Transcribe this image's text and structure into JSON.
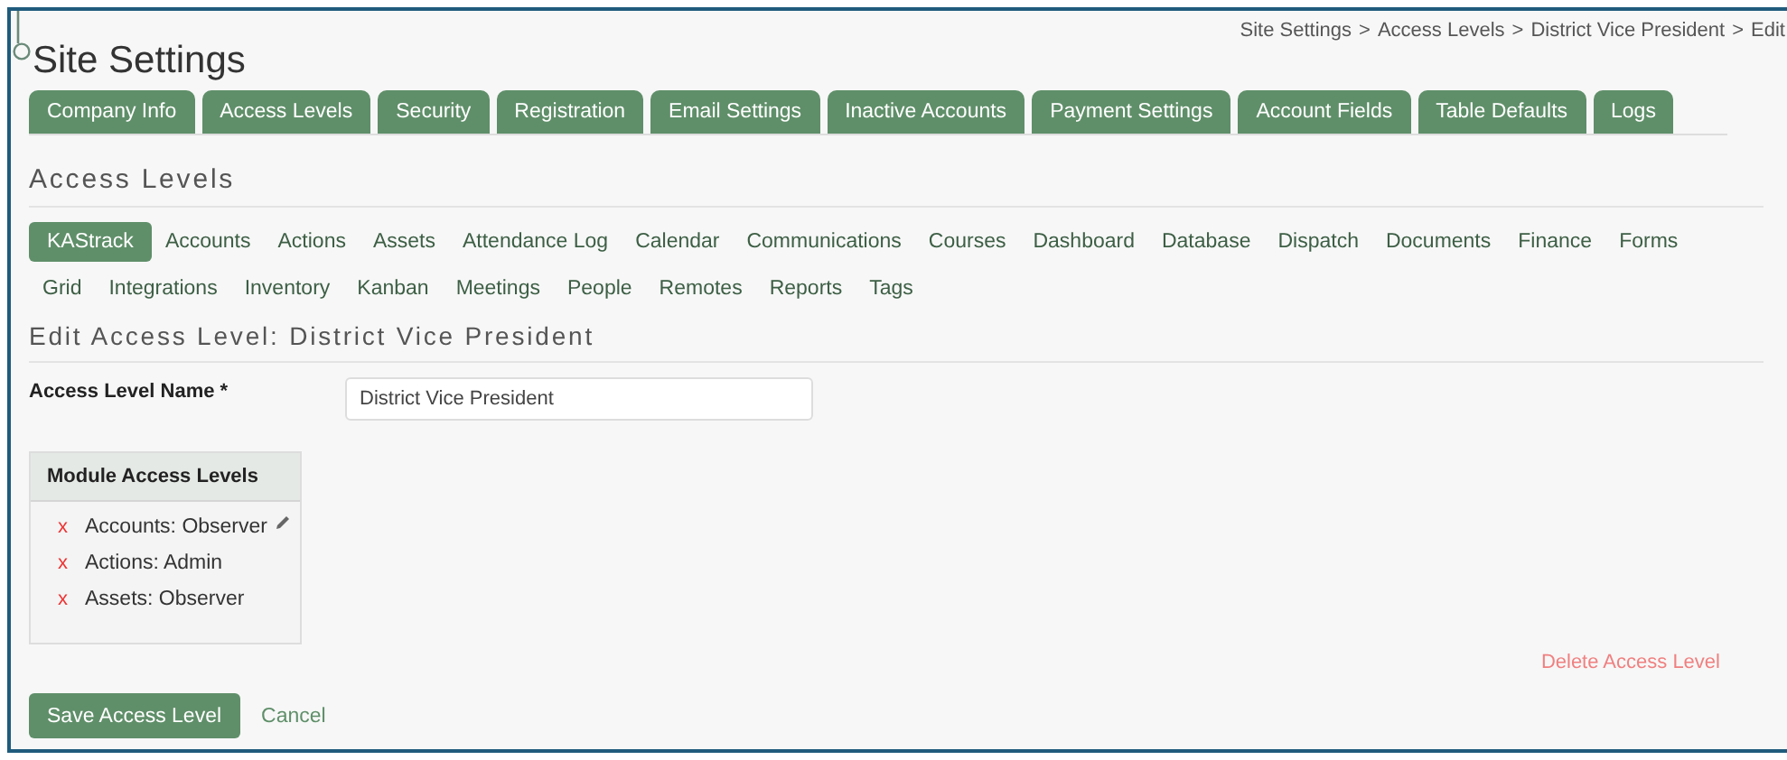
{
  "page": {
    "title": "Site Settings"
  },
  "breadcrumb": {
    "separator": ">",
    "items": [
      "Site Settings",
      "Access Levels",
      "District Vice President",
      "Edit"
    ]
  },
  "tabs": [
    "Company Info",
    "Access Levels",
    "Security",
    "Registration",
    "Email Settings",
    "Inactive Accounts",
    "Payment Settings",
    "Account Fields",
    "Table Defaults",
    "Logs"
  ],
  "section_title": "Access Levels",
  "modules": [
    {
      "label": "KAStrack",
      "selected": true
    },
    {
      "label": "Accounts",
      "selected": false
    },
    {
      "label": "Actions",
      "selected": false
    },
    {
      "label": "Assets",
      "selected": false
    },
    {
      "label": "Attendance Log",
      "selected": false
    },
    {
      "label": "Calendar",
      "selected": false
    },
    {
      "label": "Communications",
      "selected": false
    },
    {
      "label": "Courses",
      "selected": false
    },
    {
      "label": "Dashboard",
      "selected": false
    },
    {
      "label": "Database",
      "selected": false
    },
    {
      "label": "Dispatch",
      "selected": false
    },
    {
      "label": "Documents",
      "selected": false
    },
    {
      "label": "Finance",
      "selected": false
    },
    {
      "label": "Forms",
      "selected": false
    },
    {
      "label": "Grid",
      "selected": false
    },
    {
      "label": "Integrations",
      "selected": false
    },
    {
      "label": "Inventory",
      "selected": false
    },
    {
      "label": "Kanban",
      "selected": false
    },
    {
      "label": "Meetings",
      "selected": false
    },
    {
      "label": "People",
      "selected": false
    },
    {
      "label": "Remotes",
      "selected": false
    },
    {
      "label": "Reports",
      "selected": false
    },
    {
      "label": "Tags",
      "selected": false
    }
  ],
  "edit_title": "Edit Access Level: District Vice President",
  "name_field": {
    "label": "Access Level Name *",
    "value": "District Vice President"
  },
  "module_access": {
    "title": "Module Access Levels",
    "items": [
      {
        "remove_mark": "x",
        "label": "Accounts: Observer",
        "editable": true
      },
      {
        "remove_mark": "x",
        "label": "Actions: Admin",
        "editable": false
      },
      {
        "remove_mark": "x",
        "label": "Assets: Observer",
        "editable": false
      }
    ]
  },
  "delete_link": "Delete Access Level",
  "buttons": {
    "save": "Save Access Level",
    "cancel": "Cancel"
  }
}
